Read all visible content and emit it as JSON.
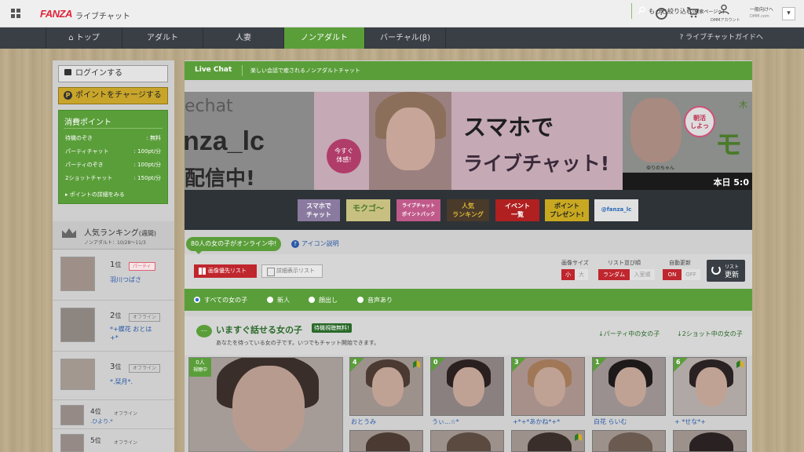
{
  "header": {
    "logo": "FANZA",
    "logo_sub": "ライブチャット",
    "account_label": "DMMアカウント",
    "general_label": "一般向けへ",
    "general_sub": "DMM.com",
    "dropdown_glyph": "▾"
  },
  "nav": {
    "items": [
      {
        "label": "⌂ トップ"
      },
      {
        "label": "アダルト"
      },
      {
        "label": "人妻"
      },
      {
        "label": "ノンアダルト"
      },
      {
        "label": "バーチャル(β)"
      }
    ],
    "guide": "? ライブチャットガイドへ"
  },
  "sidebar": {
    "login": "ログインする",
    "charge": "ポイントをチャージする",
    "points": {
      "title": "消費ポイント",
      "rows": [
        {
          "label": "待機のぞき",
          "value": ": 無料"
        },
        {
          "label": "パーティチャット",
          "value": ": 100pt/分"
        },
        {
          "label": "パーティのぞき",
          "value": ": 100pt/分"
        },
        {
          "label": "2ショットチャット",
          "value": ": 150pt/分"
        }
      ],
      "more": "▸ ポイントの詳細をみる"
    },
    "ranking": {
      "title": "人気ランキング",
      "title_suffix": "(週間)",
      "sub": "ノンアダルト：10/28～11/3",
      "items": [
        {
          "pos": "1",
          "unit": "位",
          "status": "パーティ",
          "name": "羽川つばさ"
        },
        {
          "pos": "2",
          "unit": "位",
          "status": "オフライン",
          "name": "*+蝶花 おとは",
          "name2": "+*"
        },
        {
          "pos": "3",
          "unit": "位",
          "status": "オフライン",
          "name": "*.栞月*."
        },
        {
          "pos": "4",
          "unit": "位",
          "status": "オフライン",
          "name": ".ひより.*"
        },
        {
          "pos": "5",
          "unit": "位",
          "status": "オフライン"
        }
      ]
    }
  },
  "main": {
    "livechat_title": "Live Chat",
    "livechat_desc": "楽しい会話で癒されるノンアダルトチャット",
    "banner_left": {
      "t1": "echat",
      "t2": "nza_lc",
      "t3": "配信中!"
    },
    "banner_main": {
      "circle": "今すぐ\n体感!",
      "line1": "スマホで",
      "line2": "ライブチャット!"
    },
    "banner_right": {
      "badge": "朝活\nしよっ",
      "big": "モ",
      "ki": "木",
      "name": "ゆりのちゃん",
      "foot": "本日 5:0"
    },
    "mini_banners": [
      {
        "label": "スマホで\nチャット"
      },
      {
        "label": "モクゴ〜"
      },
      {
        "label": "ライブチャット\nポイントパック"
      },
      {
        "label": "人気\nランキング"
      },
      {
        "label": "イベント\n一覧"
      },
      {
        "label": "ポイント\nプレゼント!"
      },
      {
        "label": "@fanza_lc"
      }
    ],
    "online": "80人の女の子がオンライン中!",
    "icon_help": "アイコン説明",
    "view_image": "画像優先リスト",
    "view_detail": "詳細表示リスト",
    "options": {
      "size_label": "画像サイズ",
      "size_small": "小",
      "size_large": "大",
      "order_label": "リスト並び順",
      "order_random": "ランダム",
      "order_new": "入室順",
      "auto_label": "自動更新",
      "auto_on": "ON",
      "auto_off": "OFF",
      "refresh_top": "リスト",
      "refresh_bottom": "更新"
    },
    "filters": [
      {
        "label": "すべての女の子",
        "selected": true
      },
      {
        "label": "新人",
        "selected": false
      },
      {
        "label": "顔出し",
        "selected": false
      },
      {
        "label": "音声あり",
        "selected": false
      }
    ],
    "filter_more": "もっと絞り込む",
    "filter_more_sub": "(検索ページへ)",
    "talk_title": "いますぐ話せる女の子",
    "talk_free": "待機視聴無料!",
    "talk_sub": "あなたを待っている女の子です。いつでもチャット開始できます。",
    "link_party": "パーティ中の女の子",
    "link_two": "2ショット中の女の子",
    "big_card": {
      "count": "0人",
      "status": "視聴中"
    },
    "cards": [
      {
        "num": "4",
        "name": "おとうみ"
      },
      {
        "num": "0",
        "name": "うぃ...☆*"
      },
      {
        "num": "3",
        "name": "+*+*あかね*+*"
      },
      {
        "num": "1",
        "name": "白花 らいむ"
      },
      {
        "num": "6",
        "name": "+ *せな*+"
      }
    ]
  }
}
